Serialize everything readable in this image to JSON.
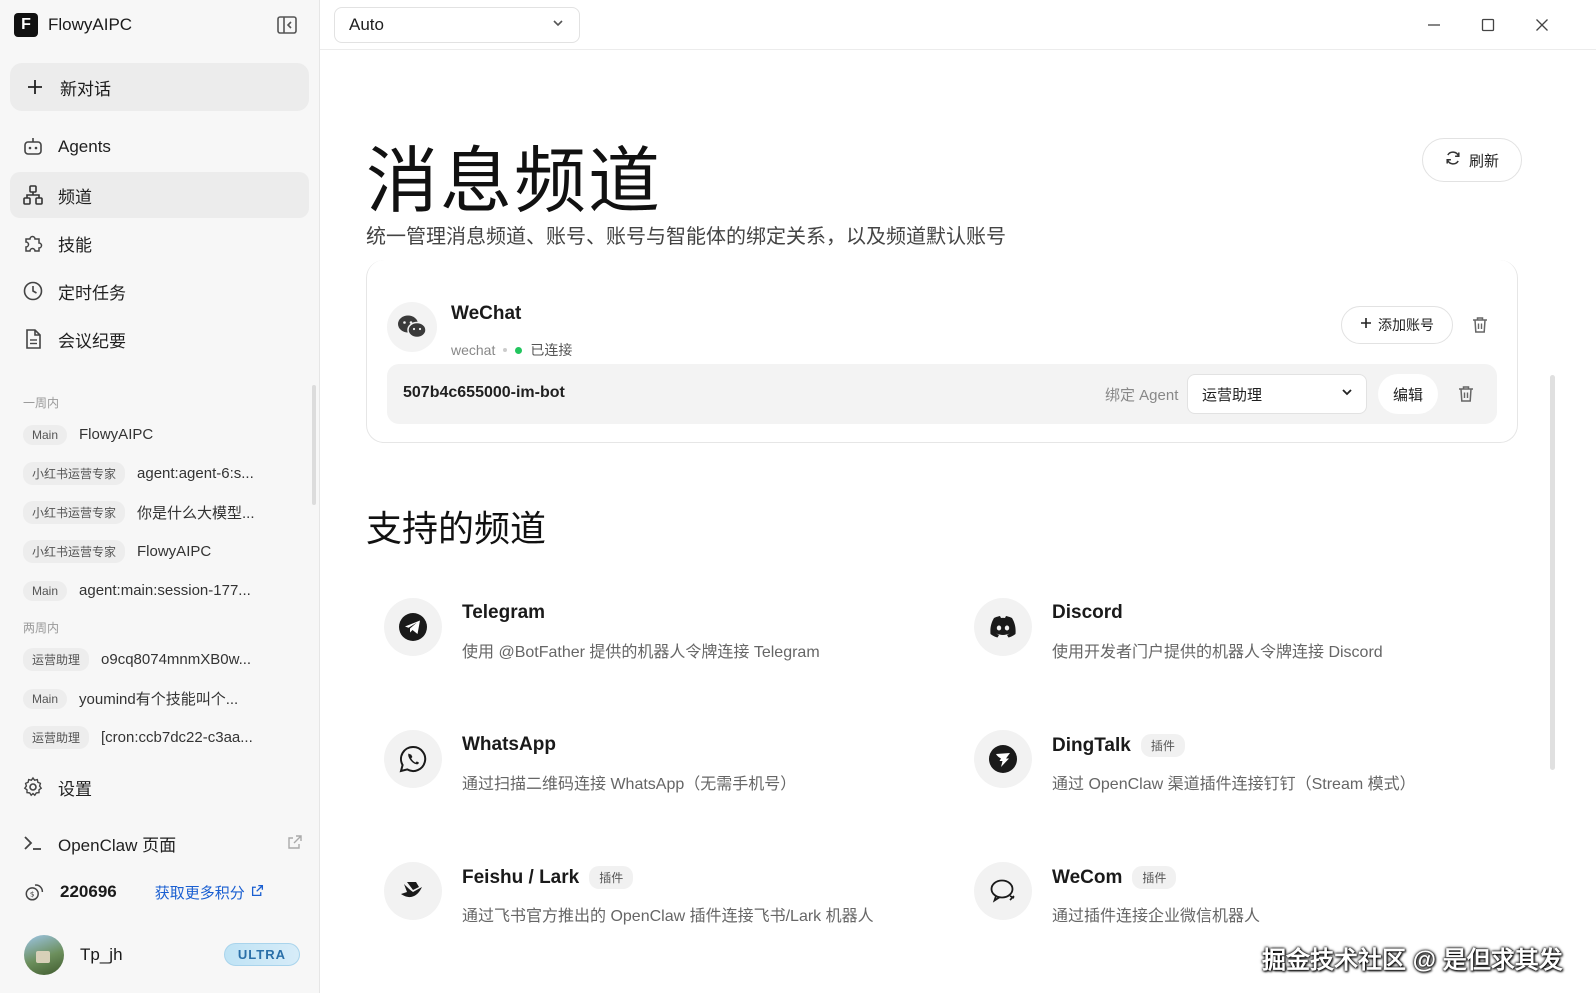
{
  "app": {
    "name": "FlowyAIPC",
    "logo_letter": "F"
  },
  "sidebar": {
    "new_chat": "新对话",
    "nav": [
      {
        "label": "Agents",
        "icon": "robot-icon"
      },
      {
        "label": "频道",
        "icon": "channels-icon",
        "active": true
      },
      {
        "label": "技能",
        "icon": "puzzle-icon"
      },
      {
        "label": "定时任务",
        "icon": "clock-icon"
      },
      {
        "label": "会议纪要",
        "icon": "document-icon"
      }
    ],
    "groups": [
      {
        "label": "一周内",
        "items": [
          {
            "tag": "Main",
            "text": "FlowyAIPC"
          },
          {
            "tag": "小红书运营专家",
            "text": "agent:agent-6:s..."
          },
          {
            "tag": "小红书运营专家",
            "text": "你是什么大模型..."
          },
          {
            "tag": "小红书运营专家",
            "text": "FlowyAIPC"
          },
          {
            "tag": "Main",
            "text": "agent:main:session-177..."
          }
        ]
      },
      {
        "label": "两周内",
        "items": [
          {
            "tag": "运营助理",
            "text": "o9cq8074mnmXB0w..."
          },
          {
            "tag": "Main",
            "text": "youmind有个技能叫个..."
          },
          {
            "tag": "运营助理",
            "text": "[cron:ccb7dc22-c3aa..."
          }
        ]
      }
    ],
    "settings": "设置",
    "openclaw": "OpenClaw 页面",
    "credits": {
      "value": "220696",
      "more": "获取更多积分"
    },
    "user": {
      "name": "Tp_jh",
      "badge": "ULTRA"
    }
  },
  "topbar": {
    "model": "Auto"
  },
  "main": {
    "title": "消息频道",
    "subtitle": "统一管理消息频道、账号、账号与智能体的绑定关系，以及频道默认账号",
    "refresh": "刷新",
    "channel": {
      "name": "WeChat",
      "id": "wechat",
      "status": "已连接",
      "add_account": "添加账号",
      "account": {
        "id": "507b4c655000-im-bot",
        "bind_label": "绑定 Agent",
        "agent": "运营助理",
        "edit": "编辑"
      }
    },
    "supported_title": "支持的频道",
    "supported": [
      {
        "name": "Telegram",
        "desc": "使用 @BotFather 提供的机器人令牌连接 Telegram",
        "icon": "telegram-icon",
        "plugin": ""
      },
      {
        "name": "Discord",
        "desc": "使用开发者门户提供的机器人令牌连接 Discord",
        "icon": "discord-icon",
        "plugin": ""
      },
      {
        "name": "WhatsApp",
        "desc": "通过扫描二维码连接 WhatsApp（无需手机号）",
        "icon": "whatsapp-icon",
        "plugin": ""
      },
      {
        "name": "DingTalk",
        "desc": "通过 OpenClaw 渠道插件连接钉钉（Stream 模式）",
        "icon": "dingtalk-icon",
        "plugin": "插件"
      },
      {
        "name": "Feishu / Lark",
        "desc": "通过飞书官方推出的 OpenClaw 插件连接飞书/Lark 机器人",
        "icon": "feishu-icon",
        "plugin": "插件"
      },
      {
        "name": "WeCom",
        "desc": "通过插件连接企业微信机器人",
        "icon": "wecom-icon",
        "plugin": "插件"
      }
    ]
  },
  "watermark": "掘金技术社区 @ 是但求其发"
}
